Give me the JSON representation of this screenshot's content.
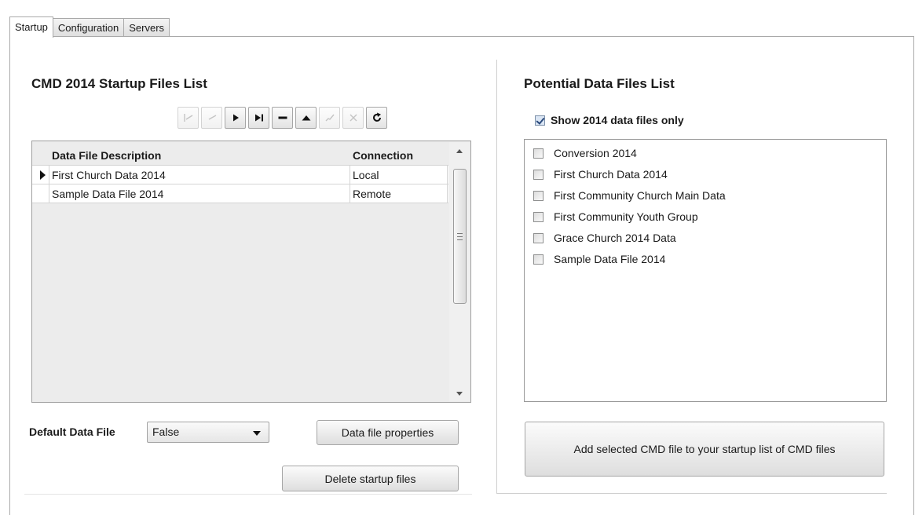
{
  "tabs": [
    {
      "label": "Startup",
      "active": true
    },
    {
      "label": "Configuration",
      "active": false
    },
    {
      "label": "Servers",
      "active": false
    }
  ],
  "startup_list": {
    "title": "CMD 2014 Startup Files List",
    "nav_buttons": [
      {
        "icon": "first-record-icon",
        "enabled": false
      },
      {
        "icon": "prior-record-icon",
        "enabled": false
      },
      {
        "icon": "next-record-icon",
        "enabled": true
      },
      {
        "icon": "last-record-icon",
        "enabled": true
      },
      {
        "icon": "delete-record-icon",
        "enabled": true
      },
      {
        "icon": "edit-record-icon",
        "enabled": true
      },
      {
        "icon": "post-edit-icon",
        "enabled": false
      },
      {
        "icon": "cancel-edit-icon",
        "enabled": false
      },
      {
        "icon": "refresh-icon",
        "enabled": true
      }
    ],
    "columns": {
      "description": "Data File Description",
      "connection": "Connection"
    },
    "rows": [
      {
        "description": "First Church Data 2014",
        "connection": "Local",
        "current": true
      },
      {
        "description": "Sample Data File 2014",
        "connection": "Remote",
        "current": false
      }
    ],
    "default_label": "Default Data File",
    "default_value": "False",
    "properties_button": "Data file properties",
    "delete_button": "Delete startup files"
  },
  "potential_list": {
    "title": "Potential Data Files List",
    "show_only_label": "Show 2014 data files only",
    "show_only_checked": true,
    "items": [
      {
        "label": "Conversion 2014",
        "checked": false
      },
      {
        "label": "First Church Data 2014",
        "checked": false
      },
      {
        "label": "First Community Church Main Data",
        "checked": false
      },
      {
        "label": "First Community Youth Group",
        "checked": false
      },
      {
        "label": "Grace Church 2014 Data",
        "checked": false
      },
      {
        "label": "Sample Data File 2014",
        "checked": false
      }
    ],
    "add_button": "Add selected CMD file to your startup list of CMD files"
  }
}
